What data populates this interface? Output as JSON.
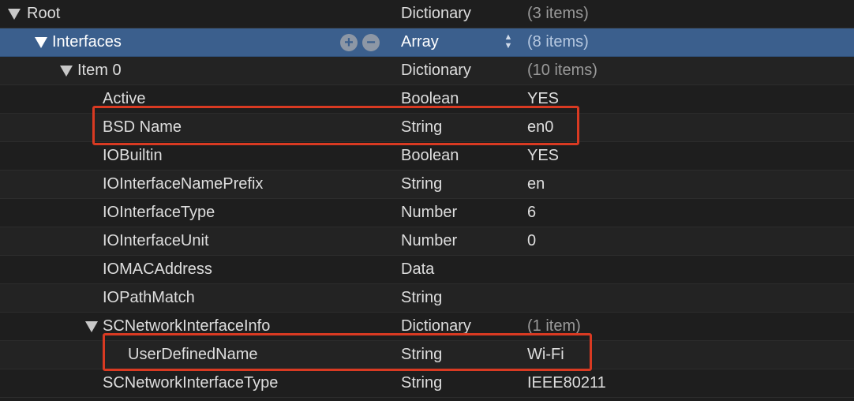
{
  "rows": [
    {
      "key": "Root",
      "type": "Dictionary",
      "value": "(3 items)"
    },
    {
      "key": "Interfaces",
      "type": "Array",
      "value": "(8 items)"
    },
    {
      "key": "Item 0",
      "type": "Dictionary",
      "value": "(10 items)"
    },
    {
      "key": "Active",
      "type": "Boolean",
      "value": "YES"
    },
    {
      "key": "BSD Name",
      "type": "String",
      "value": "en0"
    },
    {
      "key": "IOBuiltin",
      "type": "Boolean",
      "value": "YES"
    },
    {
      "key": "IOInterfaceNamePrefix",
      "type": "String",
      "value": "en"
    },
    {
      "key": "IOInterfaceType",
      "type": "Number",
      "value": "6"
    },
    {
      "key": "IOInterfaceUnit",
      "type": "Number",
      "value": "0"
    },
    {
      "key": "IOMACAddress",
      "type": "Data",
      "value": ""
    },
    {
      "key": "IOPathMatch",
      "type": "String",
      "value": ""
    },
    {
      "key": "SCNetworkInterfaceInfo",
      "type": "Dictionary",
      "value": "(1 item)"
    },
    {
      "key": "UserDefinedName",
      "type": "String",
      "value": "Wi-Fi"
    },
    {
      "key": "SCNetworkInterfaceType",
      "type": "String",
      "value": "IEEE80211"
    }
  ],
  "controls": {
    "add_symbol": "+",
    "remove_symbol": "−",
    "stepper_up": "▲",
    "stepper_down": "▼"
  },
  "colors": {
    "background": "#1e1e1e",
    "selection": "#3b5f8d",
    "highlight_box": "#d93a22"
  }
}
